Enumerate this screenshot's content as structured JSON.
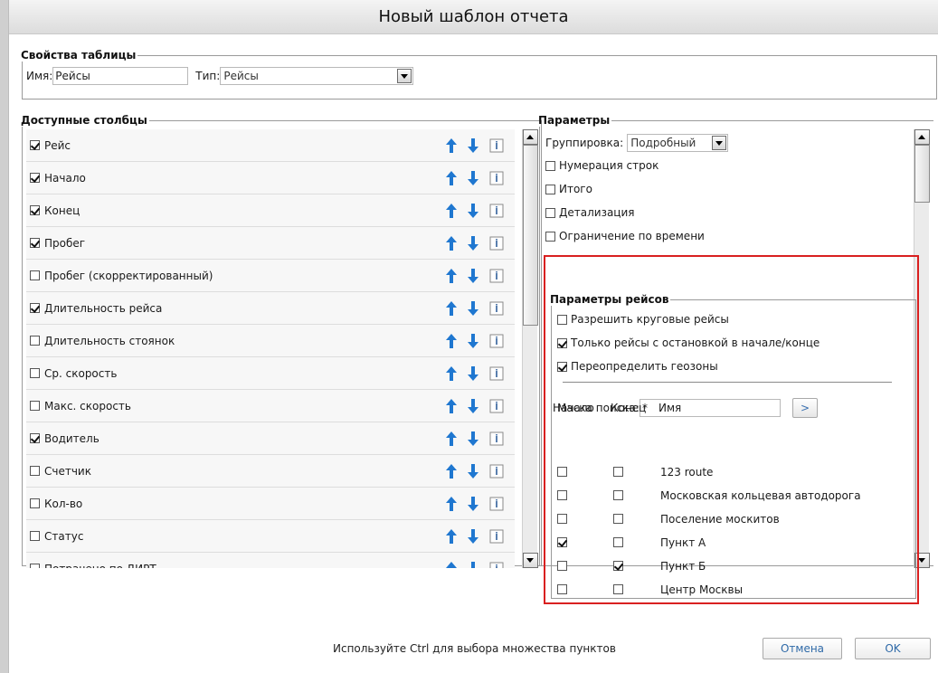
{
  "dialog": {
    "title": "Новый шаблон отчета"
  },
  "props": {
    "legend": "Свойства таблицы",
    "name_label": "Имя:",
    "name_value": "Рейсы",
    "type_label": "Тип:",
    "type_value": "Рейсы"
  },
  "columns": {
    "legend": "Доступные столбцы",
    "items": [
      {
        "label": "Рейс",
        "checked": true
      },
      {
        "label": "Начало",
        "checked": true
      },
      {
        "label": "Конец",
        "checked": true
      },
      {
        "label": "Пробег",
        "checked": true
      },
      {
        "label": "Пробег (скорректированный)",
        "checked": false
      },
      {
        "label": "Длительность рейса",
        "checked": true
      },
      {
        "label": "Длительность стоянок",
        "checked": false
      },
      {
        "label": "Ср. скорость",
        "checked": false
      },
      {
        "label": "Макс. скорость",
        "checked": false
      },
      {
        "label": "Водитель",
        "checked": true
      },
      {
        "label": "Счетчик",
        "checked": false
      },
      {
        "label": "Кол-во",
        "checked": false
      },
      {
        "label": "Статус",
        "checked": false
      },
      {
        "label": "Потрачено по ДИРТ",
        "checked": false
      }
    ]
  },
  "params": {
    "legend": "Параметры",
    "grouping_label": "Группировка:",
    "grouping_value": "Подробный",
    "options": [
      {
        "label": "Нумерация строк",
        "checked": false
      },
      {
        "label": "Итого",
        "checked": false
      },
      {
        "label": "Детализация",
        "checked": false
      },
      {
        "label": "Ограничение по времени",
        "checked": false
      }
    ]
  },
  "trip": {
    "legend": "Параметры рейсов",
    "options": [
      {
        "label": "Разрешить круговые рейсы",
        "checked": false
      },
      {
        "label": "Только рейсы с остановкой в начале/конце",
        "checked": true
      },
      {
        "label": "Переопределить геозоны",
        "checked": true
      }
    ],
    "mask_label": "Маска поиска:",
    "mask_value": "*",
    "mask_button": ">",
    "headers": {
      "start": "Начало",
      "end": "Конец",
      "name": "Имя"
    },
    "zones": [
      {
        "name": "123 route",
        "start": false,
        "end": false
      },
      {
        "name": "Московская кольцевая автодорога",
        "start": false,
        "end": false
      },
      {
        "name": "Поселение москитов",
        "start": false,
        "end": false
      },
      {
        "name": "Пункт А",
        "start": true,
        "end": false
      },
      {
        "name": "Пункт Б",
        "start": false,
        "end": true
      },
      {
        "name": "Центр Москвы",
        "start": false,
        "end": false
      }
    ]
  },
  "footer": {
    "hint": "Используйте Ctrl для выбора множества пунктов",
    "cancel": "Отмена",
    "ok": "OK"
  },
  "colors": {
    "arrow": "#1f77d0",
    "highlight": "#d92020"
  },
  "icons": {
    "up": "arrow-up-icon",
    "down": "arrow-down-icon",
    "info": "info-icon"
  }
}
